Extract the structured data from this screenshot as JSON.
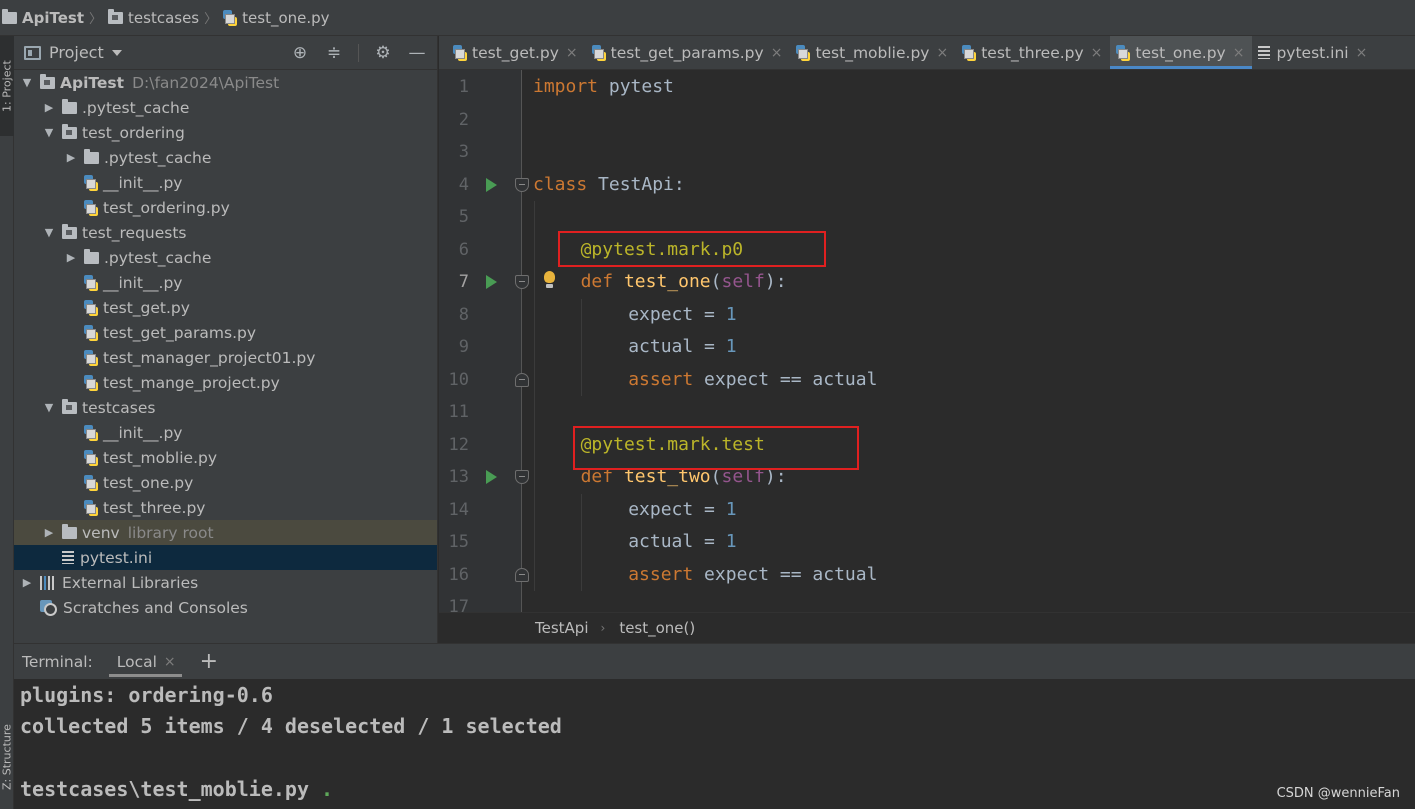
{
  "breadcrumb": {
    "project": "ApiTest",
    "folder": "testcases",
    "file": "test_one.py"
  },
  "stripe": {
    "project_tab": "1: Project",
    "structure_tab": "Z: Structure"
  },
  "project_panel": {
    "title": "Project",
    "tools": [
      "target-icon",
      "collapse-icon",
      "gear-icon",
      "minimize-icon"
    ],
    "tree": [
      {
        "label": "ApiTest",
        "extra": "D:\\fan2024\\ApiTest",
        "type": "module-folder",
        "expanded": true
      },
      {
        "label": ".pytest_cache",
        "type": "folder",
        "expanded": false
      },
      {
        "label": "test_ordering",
        "type": "module-folder",
        "expanded": true
      },
      {
        "label": ".pytest_cache",
        "type": "folder",
        "expanded": false
      },
      {
        "label": "__init__.py",
        "type": "python-file"
      },
      {
        "label": "test_ordering.py",
        "type": "python-file"
      },
      {
        "label": "test_requests",
        "type": "module-folder",
        "expanded": true
      },
      {
        "label": ".pytest_cache",
        "type": "folder",
        "expanded": false
      },
      {
        "label": "__init__.py",
        "type": "python-file"
      },
      {
        "label": "test_get.py",
        "type": "python-file"
      },
      {
        "label": "test_get_params.py",
        "type": "python-file"
      },
      {
        "label": "test_manager_project01.py",
        "type": "python-file"
      },
      {
        "label": "test_mange_project.py",
        "type": "python-file"
      },
      {
        "label": "testcases",
        "type": "module-folder",
        "expanded": true
      },
      {
        "label": "__init__.py",
        "type": "python-file"
      },
      {
        "label": "test_moblie.py",
        "type": "python-file"
      },
      {
        "label": "test_one.py",
        "type": "python-file"
      },
      {
        "label": "test_three.py",
        "type": "python-file"
      },
      {
        "label": "venv",
        "extra": "library root",
        "type": "folder",
        "expanded": false
      },
      {
        "label": "pytest.ini",
        "type": "ini-file"
      },
      {
        "label": "External Libraries",
        "type": "libraries",
        "expanded": false
      },
      {
        "label": "Scratches and Consoles",
        "type": "scratches"
      }
    ]
  },
  "tabs": [
    {
      "label": "test_get.py",
      "icon": "python-file-icon"
    },
    {
      "label": "test_get_params.py",
      "icon": "python-file-icon"
    },
    {
      "label": "test_moblie.py",
      "icon": "python-file-icon"
    },
    {
      "label": "test_three.py",
      "icon": "python-file-icon"
    },
    {
      "label": "test_one.py",
      "icon": "python-file-icon",
      "active": true
    },
    {
      "label": "pytest.ini",
      "icon": "ini-file-icon"
    }
  ],
  "editor": {
    "line_numbers": [
      "1",
      "2",
      "3",
      "4",
      "5",
      "6",
      "7",
      "8",
      "9",
      "10",
      "11",
      "12",
      "13",
      "14",
      "15",
      "16",
      "17"
    ],
    "current_line": "7",
    "code": {
      "l1_kw": "import",
      "l1_rest": " pytest",
      "l4_kw": "class",
      "l4_rest": " TestApi:",
      "l6_dec": "@pytest.mark.p0",
      "l7_kw": "def",
      "l7_fn": "test_one",
      "l7_self": "self",
      "l7_open": "(",
      "l7_close": "):",
      "l8_var": "expect = ",
      "l8_num": "1",
      "l9_var": "actual = ",
      "l9_num": "1",
      "l10_kw": "assert",
      "l10_rest": " expect == actual",
      "l12_dec": "@pytest.mark.test",
      "l13_kw": "def",
      "l13_fn": "test_two",
      "l13_self": "self",
      "l13_open": "(",
      "l13_close": "):",
      "l14_var": "expect = ",
      "l14_num": "1",
      "l15_var": "actual = ",
      "l15_num": "1",
      "l16_kw": "assert",
      "l16_rest": " expect == actual"
    },
    "breadcrumb": {
      "class": "TestApi",
      "method": "test_one()"
    },
    "highlight_color": "#e02020"
  },
  "terminal": {
    "label": "Terminal:",
    "tab": "Local",
    "lines": {
      "plugins": "plugins: ordering-0.6",
      "collected": "collected 5 items / 4 deselected / 1 selected",
      "result_file": "testcases\\test_moblie.py",
      "result_status": "."
    }
  },
  "watermark": "CSDN @wennieFan",
  "colors": {
    "keyword": "#cc7832",
    "decorator": "#bbb529",
    "function": "#ffc66d",
    "self": "#94558d",
    "number": "#6897bb",
    "run_icon": "#499c54",
    "active_tab_underline": "#4a88c7"
  }
}
